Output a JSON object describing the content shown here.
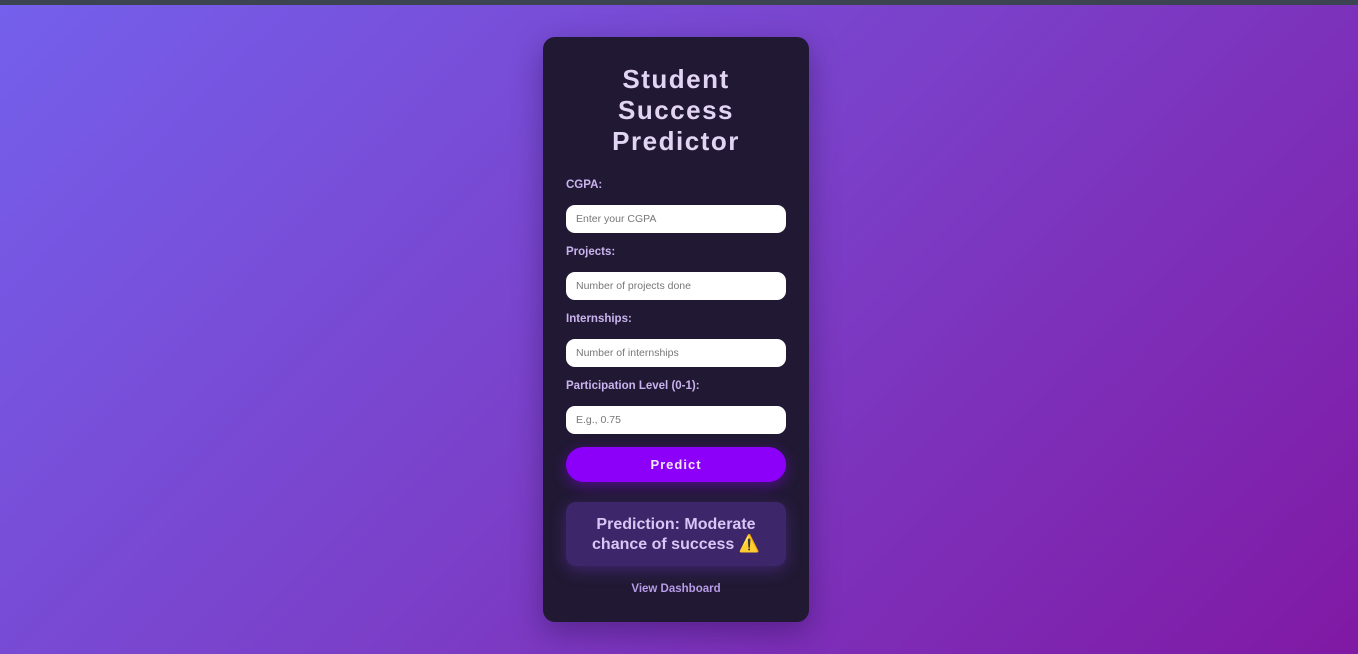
{
  "app": {
    "title": "Student Success Predictor"
  },
  "form": {
    "fields": [
      {
        "label": "CGPA:",
        "placeholder": "Enter your CGPA",
        "value": ""
      },
      {
        "label": "Projects:",
        "placeholder": "Number of projects done",
        "value": ""
      },
      {
        "label": "Internships:",
        "placeholder": "Number of internships",
        "value": ""
      },
      {
        "label": "Participation Level (0-1):",
        "placeholder": "E.g., 0.75",
        "value": ""
      }
    ],
    "predict_label": "Predict"
  },
  "result": {
    "text": "Prediction: Moderate chance of success",
    "icon": "warning-icon",
    "icon_glyph": "⚠️"
  },
  "links": {
    "dashboard": "View Dashboard"
  },
  "colors": {
    "accent": "#8c00fa",
    "card_bg": "#211933",
    "result_bg": "#3d2669",
    "warning": "#f6c400"
  }
}
